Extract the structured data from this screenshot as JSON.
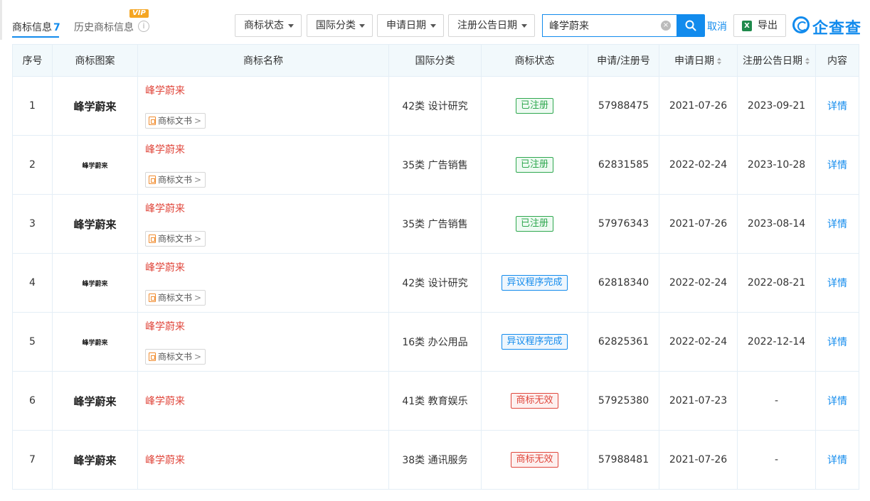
{
  "tabs": {
    "current_label": "商标信息",
    "current_count": "7",
    "history_label": "历史商标信息",
    "vip_badge": "VIP",
    "info_glyph": "i"
  },
  "filters": {
    "status": "商标状态",
    "class": "国际分类",
    "apply_date": "申请日期",
    "publish_date": "注册公告日期"
  },
  "search": {
    "value": "峰学蔚来",
    "clear_glyph": "×",
    "cancel_label": "取消"
  },
  "export": {
    "label": "导出",
    "icon_glyph": "X"
  },
  "logo": {
    "text": "企查查"
  },
  "table": {
    "headers": {
      "index": "序号",
      "image": "商标图案",
      "name": "商标名称",
      "class": "国际分类",
      "status": "商标状态",
      "reg_no": "申请/注册号",
      "apply_date": "申请日期",
      "publish_date": "注册公告日期",
      "content": "内容"
    },
    "doc_label": "商标文书",
    "detail_label": "详情",
    "rows": [
      {
        "index": "1",
        "image_text": "峰学蔚来",
        "image_size": "large",
        "name": "峰学蔚来",
        "has_doc": true,
        "class": "42类 设计研究",
        "status": "已注册",
        "status_color": "green",
        "reg_no": "57988475",
        "apply_date": "2021-07-26",
        "publish_date": "2023-09-21"
      },
      {
        "index": "2",
        "image_text": "峰学蔚来",
        "image_size": "small",
        "name": "峰学蔚来",
        "has_doc": true,
        "class": "35类 广告销售",
        "status": "已注册",
        "status_color": "green",
        "reg_no": "62831585",
        "apply_date": "2022-02-24",
        "publish_date": "2023-10-28"
      },
      {
        "index": "3",
        "image_text": "峰学蔚来",
        "image_size": "large",
        "name": "峰学蔚来",
        "has_doc": true,
        "class": "35类 广告销售",
        "status": "已注册",
        "status_color": "green",
        "reg_no": "57976343",
        "apply_date": "2021-07-26",
        "publish_date": "2023-08-14"
      },
      {
        "index": "4",
        "image_text": "峰学蔚来",
        "image_size": "small",
        "name": "峰学蔚来",
        "has_doc": true,
        "class": "42类 设计研究",
        "status": "异议程序完成",
        "status_color": "blue",
        "reg_no": "62818340",
        "apply_date": "2022-02-24",
        "publish_date": "2022-08-21"
      },
      {
        "index": "5",
        "image_text": "峰学蔚来",
        "image_size": "small",
        "name": "峰学蔚来",
        "has_doc": true,
        "class": "16类 办公用品",
        "status": "异议程序完成",
        "status_color": "blue",
        "reg_no": "62825361",
        "apply_date": "2022-02-24",
        "publish_date": "2022-12-14"
      },
      {
        "index": "6",
        "image_text": "峰学蔚来",
        "image_size": "large",
        "name": "峰学蔚来",
        "has_doc": false,
        "class": "41类 教育娱乐",
        "status": "商标无效",
        "status_color": "red",
        "reg_no": "57925380",
        "apply_date": "2021-07-23",
        "publish_date": "-"
      },
      {
        "index": "7",
        "image_text": "峰学蔚来",
        "image_size": "large",
        "name": "峰学蔚来",
        "has_doc": false,
        "class": "38类 通讯服务",
        "status": "商标无效",
        "status_color": "red",
        "reg_no": "57988481",
        "apply_date": "2021-07-26",
        "publish_date": "-"
      }
    ]
  },
  "colors": {
    "accent": "#128bed",
    "status_green": "#2fa84f",
    "status_blue": "#128bed",
    "status_red": "#e0473c",
    "header_bg": "#f2f9fc"
  }
}
